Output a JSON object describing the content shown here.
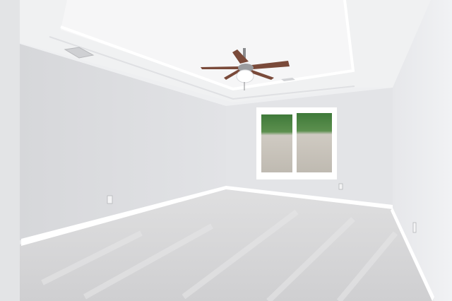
{
  "scene": {
    "kind": "empty-room-photo",
    "elements": [
      "tray-ceiling",
      "ceiling-fan",
      "hvac-vent",
      "window",
      "carpet-floor",
      "baseboards",
      "wall-outlets"
    ]
  },
  "colors": {
    "ceiling": "#f2f3f4",
    "tray_inner": "#f6f6f7",
    "left_wall": "#dcdde0",
    "back_wall": "#e4e5e8",
    "right_wall": "#eceef0",
    "carpet": "#d8d8d9",
    "trim": "#ffffff",
    "fan_blade": "#7a4a3a",
    "window_foliage": "#3f7a3a",
    "window_rock": "#c8c4bc"
  }
}
